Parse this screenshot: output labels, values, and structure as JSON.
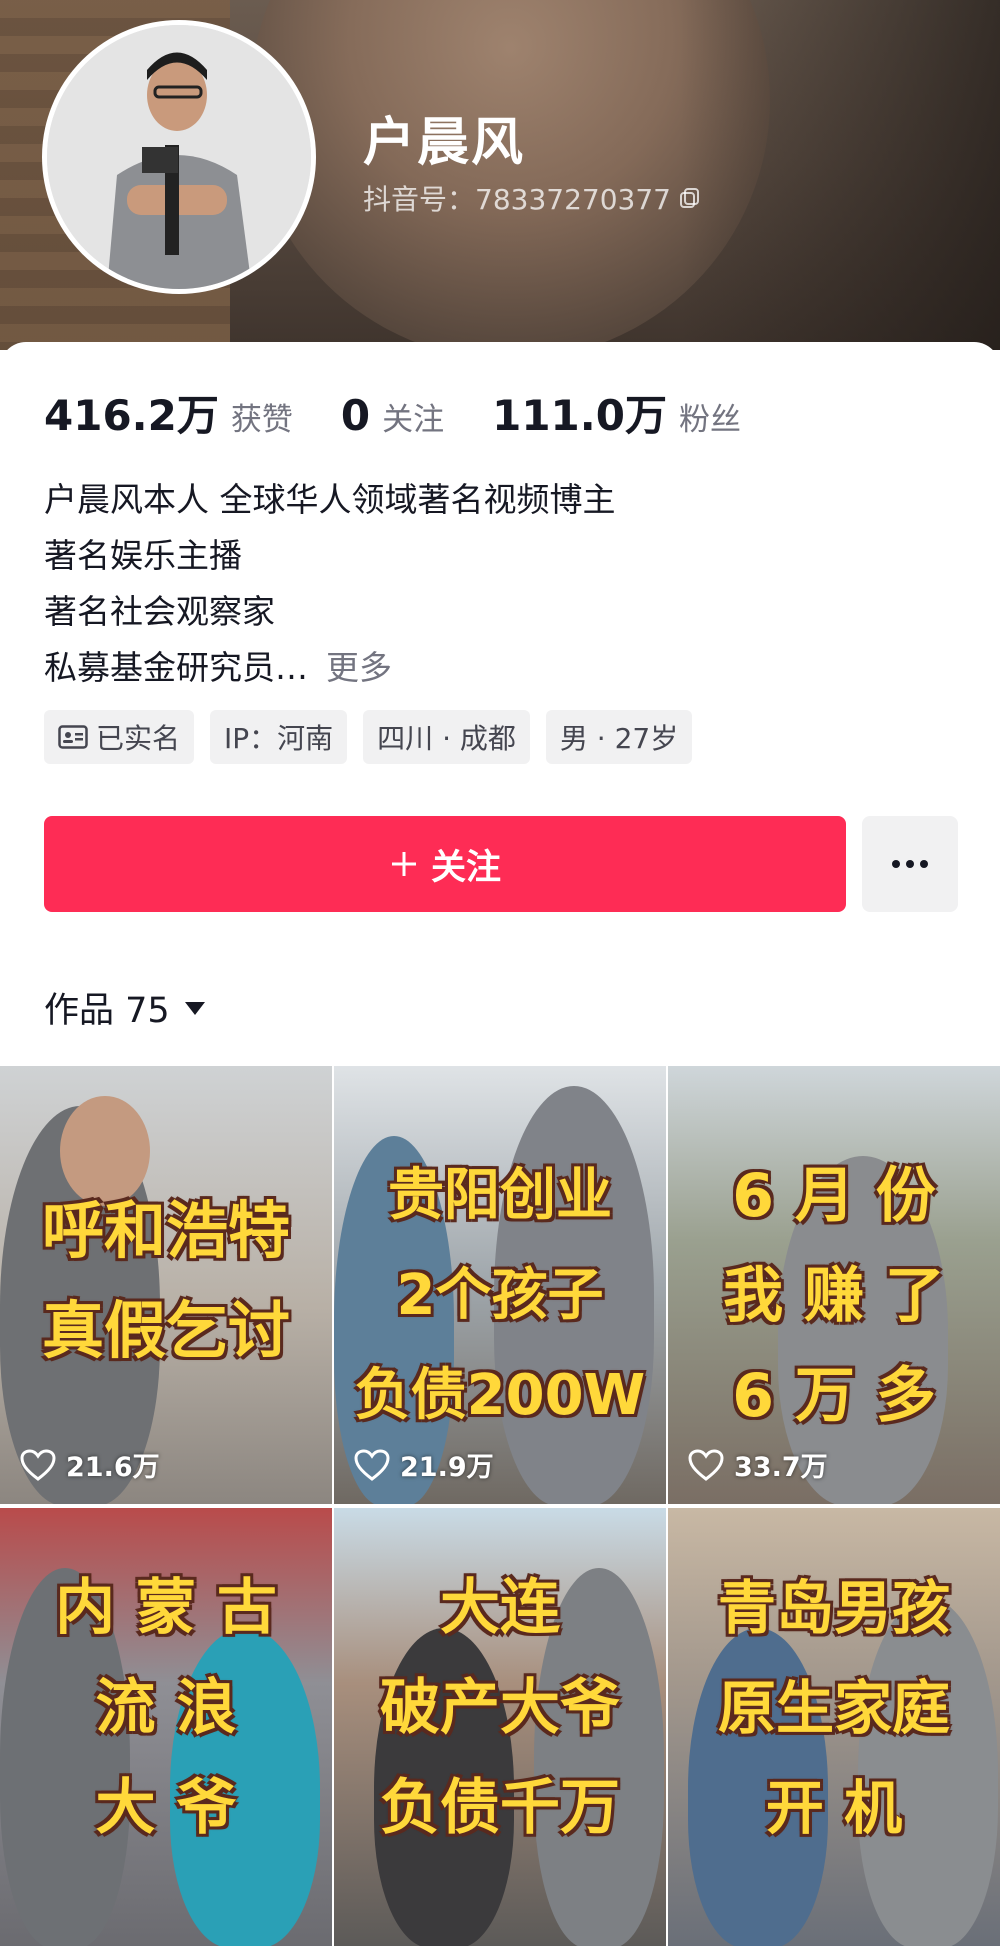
{
  "profile": {
    "name": "户晨风",
    "douyin_id": "抖音号：78337270377"
  },
  "stats": [
    {
      "value": "416.2万",
      "label": "获赞"
    },
    {
      "value": "0",
      "label": "关注"
    },
    {
      "value": "111.0万",
      "label": "粉丝"
    }
  ],
  "bio": {
    "lines": [
      "户晨风本人  全球华人领域著名视频博主",
      "著名娱乐主播",
      "著名社会观察家",
      "私募基金研究员…"
    ],
    "more": "更多"
  },
  "tags": [
    "已实名",
    "IP：河南",
    "四川 · 成都",
    "男 · 27岁"
  ],
  "actions": {
    "follow": "关注",
    "more_icon": "ellipsis-icon"
  },
  "works": {
    "label": "作品 75"
  },
  "videos": [
    {
      "lines": [
        "呼和浩特",
        "真假乞讨"
      ],
      "likes": "21.6万"
    },
    {
      "lines": [
        "贵阳创业",
        "2个孩子",
        "负债200W"
      ],
      "likes": "21.9万"
    },
    {
      "lines": [
        "6 月 份",
        "我 赚 了",
        "6 万 多"
      ],
      "likes": "33.7万"
    },
    {
      "lines": [
        "内 蒙 古",
        "流 浪",
        "大 爷"
      ],
      "likes": ""
    },
    {
      "lines": [
        "大连",
        "破产大爷",
        "负债千万"
      ],
      "likes": ""
    },
    {
      "lines": [
        "青岛男孩",
        "原生家庭",
        "开 机"
      ],
      "likes": ""
    }
  ],
  "colors": {
    "accent": "#fe2c55",
    "caption": "#ffd83a"
  }
}
